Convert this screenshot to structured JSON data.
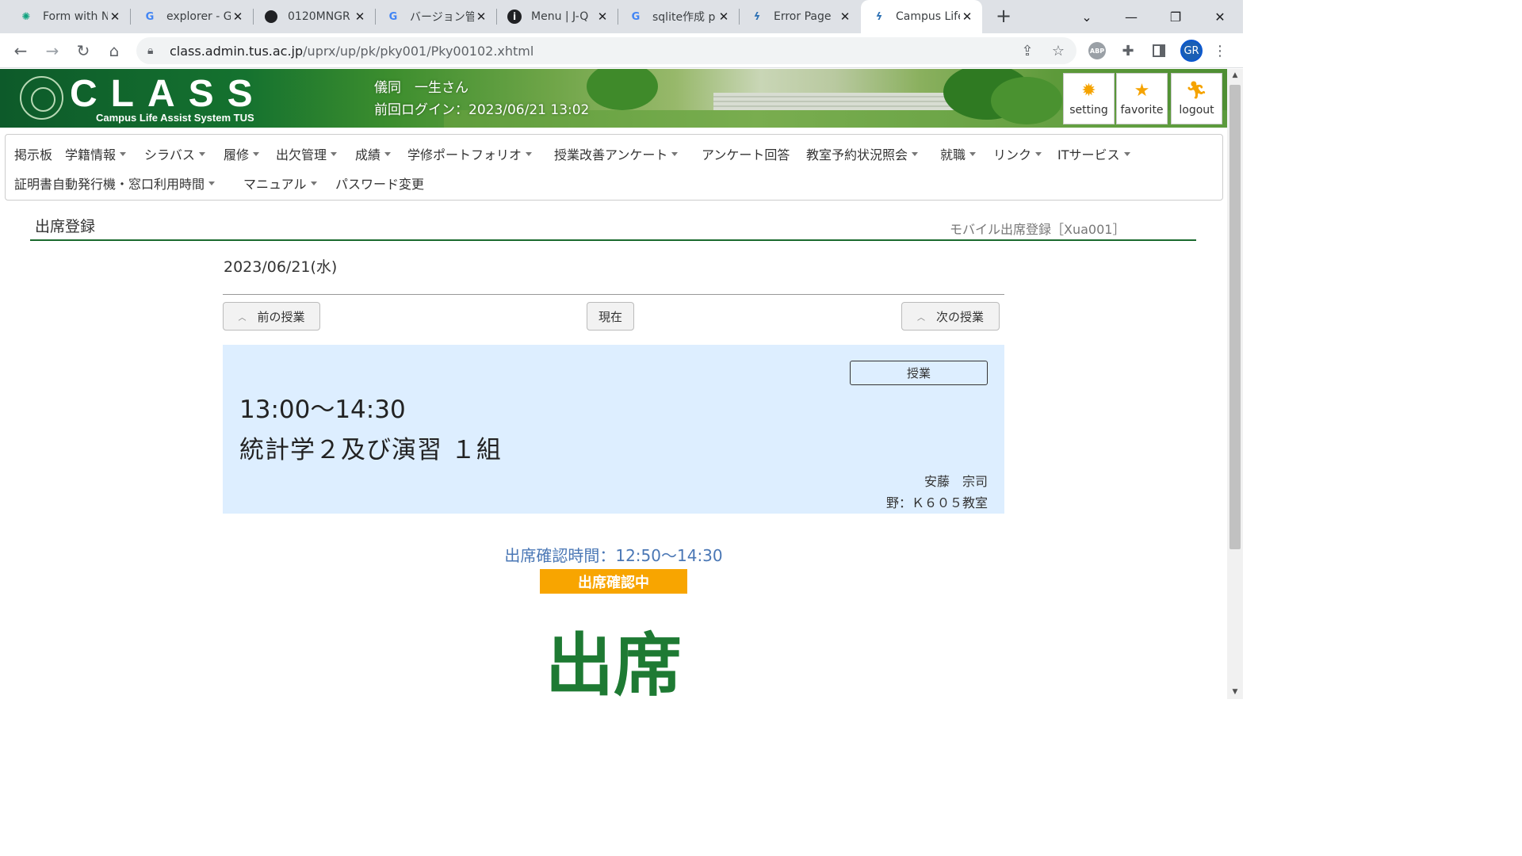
{
  "browser": {
    "tabs": [
      {
        "title": "Form with N",
        "icon": "openai-icon"
      },
      {
        "title": "explorer - G",
        "icon": "google-icon"
      },
      {
        "title": "0120MNGR",
        "icon": "github-icon"
      },
      {
        "title": "バージョン管理",
        "icon": "google-icon"
      },
      {
        "title": "Menu | J-Q",
        "icon": "info-icon"
      },
      {
        "title": "sqlite作成 p",
        "icon": "google-icon"
      },
      {
        "title": "Error Page",
        "icon": "class-icon"
      },
      {
        "title": "Campus Life",
        "icon": "class-icon"
      }
    ],
    "url_host": "class.admin.tus.ac.jp",
    "url_path": "/uprx/up/pk/pky001/Pky00102.xhtml",
    "abp_label": "ABP",
    "profile_initials": "GR"
  },
  "header": {
    "logo_word": "CLASS",
    "logo_sub": "Campus Life Assist System TUS",
    "user_name": "儀同　一生さん",
    "last_login": "前回ログイン：2023/06/21 13:02",
    "buttons": {
      "setting": "setting",
      "favorite": "favorite",
      "logout": "logout"
    }
  },
  "menu": {
    "row1": [
      "掲示板",
      "学籍情報",
      "シラバス",
      "履修",
      "出欠管理",
      "成績",
      "学修ポートフォリオ",
      "授業改善アンケート",
      "アンケート回答",
      "教室予約状況照会",
      "就職",
      "リンク",
      "ITサービス"
    ],
    "row2": [
      "証明書自動発行機・窓口利用時間",
      "マニュアル",
      "パスワード変更"
    ]
  },
  "page": {
    "title": "出席登録",
    "code": "モバイル出席登録［Xua001］",
    "date": "2023/06/21(水)",
    "prev_label": "前の授業",
    "now_label": "現在",
    "next_label": "次の授業"
  },
  "class_card": {
    "tag": "授業",
    "time": "13:00〜14:30",
    "name": "統計学２及び演習 １組",
    "teacher": "安藤　宗司",
    "room": "野：Ｋ６０５教室"
  },
  "attendance": {
    "confirm_time": "出席確認時間：12:50〜14:30",
    "status": "出席確認中",
    "result": "出席"
  },
  "colors": {
    "accent_green": "#1e7a33",
    "badge_orange": "#f8a500",
    "card_blue": "#ddeeff",
    "confirm_blue": "#4a77b5"
  }
}
